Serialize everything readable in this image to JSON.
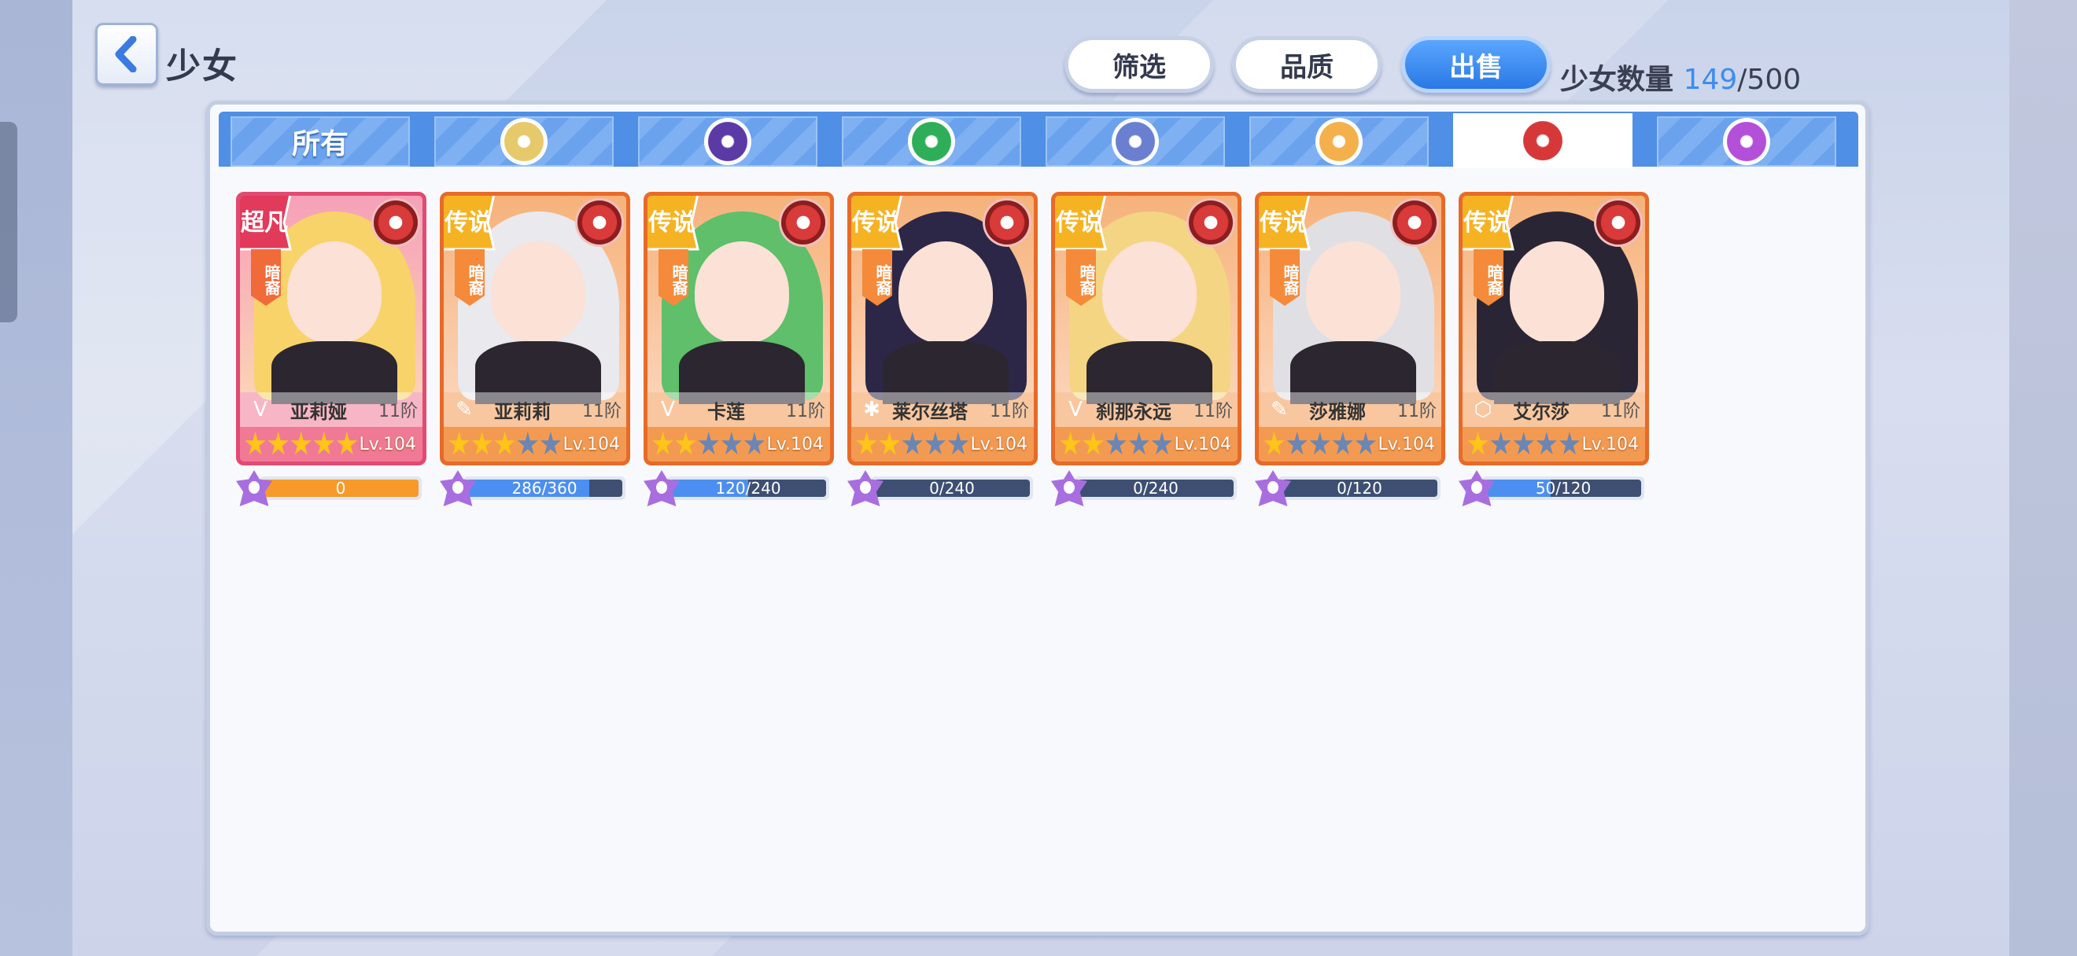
{
  "header": {
    "title": "少女",
    "buttons": {
      "filter": "筛选",
      "quality": "品质",
      "sell": "出售"
    },
    "count_label": "少女数量",
    "count_current": "149",
    "count_max": "/500"
  },
  "tabs": [
    {
      "label": "所有",
      "icon": null
    },
    {
      "label": "",
      "icon": "light-faction-icon",
      "color": "#e6c96b"
    },
    {
      "label": "",
      "icon": "dark-purple-faction-icon",
      "color": "#5c3aa6"
    },
    {
      "label": "",
      "icon": "nature-faction-icon",
      "color": "#2fae5a"
    },
    {
      "label": "",
      "icon": "machine-faction-icon",
      "color": "#6b7fd0"
    },
    {
      "label": "",
      "icon": "sun-faction-icon",
      "color": "#f4b04a"
    },
    {
      "label": "",
      "icon": "fire-faction-icon",
      "color": "#d6383a",
      "active": true
    },
    {
      "label": "",
      "icon": "swirl-faction-icon",
      "color": "#b34fd8"
    }
  ],
  "cards": [
    {
      "name": "亚莉娅",
      "stage": "11阶",
      "level": "Lv.104",
      "stars": 5,
      "rank": "超凡",
      "element": "暗裔",
      "class_icon": "wing-class-icon",
      "progress_text": "0",
      "progress": 1.0,
      "progress_color": "orange",
      "special": true,
      "hair": "#f7d36a"
    },
    {
      "name": "亚莉莉",
      "stage": "11阶",
      "level": "Lv.104",
      "stars": 3,
      "rank": "传说",
      "element": "暗裔",
      "class_icon": "quill-class-icon",
      "progress_text": "286/360",
      "progress": 0.79,
      "progress_color": "blue",
      "special": false,
      "hair": "#e9e9ee"
    },
    {
      "name": "卡莲",
      "stage": "11阶",
      "level": "Lv.104",
      "stars": 2,
      "rank": "传说",
      "element": "暗裔",
      "class_icon": "wing-class-icon",
      "progress_text": "120/240",
      "progress": 0.5,
      "progress_color": "blue",
      "special": false,
      "hair": "#5fbf6a"
    },
    {
      "name": "莱尔丝塔",
      "stage": "11阶",
      "level": "Lv.104",
      "stars": 2,
      "rank": "传说",
      "element": "暗裔",
      "class_icon": "sparkle-class-icon",
      "progress_text": "0/240",
      "progress": 0.0,
      "progress_color": "blue",
      "special": false,
      "hair": "#2d2747"
    },
    {
      "name": "刹那永远",
      "stage": "11阶",
      "level": "Lv.104",
      "stars": 2,
      "rank": "传说",
      "element": "暗裔",
      "class_icon": "wing-class-icon",
      "progress_text": "0/240",
      "progress": 0.0,
      "progress_color": "blue",
      "special": false,
      "hair": "#f4d583"
    },
    {
      "name": "莎雅娜",
      "stage": "11阶",
      "level": "Lv.104",
      "stars": 1,
      "rank": "传说",
      "element": "暗裔",
      "class_icon": "quill-class-icon",
      "progress_text": "0/120",
      "progress": 0.0,
      "progress_color": "blue",
      "special": false,
      "hair": "#e0e0e4"
    },
    {
      "name": "艾尔莎",
      "stage": "11阶",
      "level": "Lv.104",
      "stars": 1,
      "rank": "传说",
      "element": "暗裔",
      "class_icon": "shield-class-icon",
      "progress_text": "50/120",
      "progress": 0.42,
      "progress_color": "blue",
      "special": false,
      "hair": "#2a2535"
    }
  ]
}
